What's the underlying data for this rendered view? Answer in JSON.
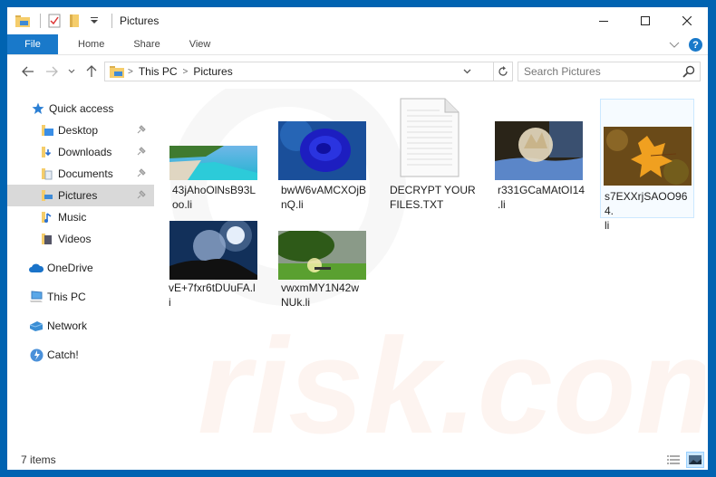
{
  "window": {
    "title": "Pictures",
    "controls": [
      "minimize",
      "maximize",
      "close"
    ]
  },
  "ribbon": {
    "tabs": [
      {
        "label": "File",
        "active": true
      },
      {
        "label": "Home"
      },
      {
        "label": "Share"
      },
      {
        "label": "View"
      }
    ],
    "help_label": "?"
  },
  "address_bar": {
    "crumbs": [
      "This PC",
      "Pictures"
    ],
    "separator": ">"
  },
  "search": {
    "placeholder": "Search Pictures"
  },
  "sidebar": {
    "items": [
      {
        "label": "Quick access",
        "icon": "star-icon",
        "level": 0
      },
      {
        "label": "Desktop",
        "icon": "desktop-folder-icon",
        "level": 1,
        "pinned": true
      },
      {
        "label": "Downloads",
        "icon": "downloads-folder-icon",
        "level": 1,
        "pinned": true
      },
      {
        "label": "Documents",
        "icon": "documents-folder-icon",
        "level": 1,
        "pinned": true
      },
      {
        "label": "Pictures",
        "icon": "pictures-folder-icon",
        "level": 1,
        "pinned": true,
        "selected": true
      },
      {
        "label": "Music",
        "icon": "music-folder-icon",
        "level": 1
      },
      {
        "label": "Videos",
        "icon": "videos-folder-icon",
        "level": 1
      },
      {
        "label": "OneDrive",
        "icon": "onedrive-icon",
        "level": 0
      },
      {
        "label": "This PC",
        "icon": "computer-icon",
        "level": 0
      },
      {
        "label": "Network",
        "icon": "network-icon",
        "level": 0
      },
      {
        "label": "Catch!",
        "icon": "catch-icon",
        "level": 0
      }
    ]
  },
  "files": [
    {
      "name": "43jAhoOlNsB93Loo.li",
      "line1": "43jAhoOlNsB93L",
      "line2": "oo.li",
      "thumb": "beach"
    },
    {
      "name": "bwW6vAMCXOjBnQ.li",
      "line1": "bwW6vAMCXOjB",
      "line2": "nQ.li",
      "thumb": "blue-rose"
    },
    {
      "name": "DECRYPT YOUR FILES.TXT",
      "line1": "DECRYPT YOUR",
      "line2": "FILES.TXT",
      "thumb": "text-document"
    },
    {
      "name": "r331GCaMAtOI14.li",
      "line1": "r331GCaMAtOI14",
      "line2": ".li",
      "thumb": "frozen-bubble"
    },
    {
      "name": "s7EXXrjSAOO964.li",
      "line1": "s7EXXrjSAOO964.",
      "line2": "li",
      "thumb": "autumn-leaf"
    },
    {
      "name": "vE+7fxr6tDUuFA.li",
      "line1": "vE+7fxr6tDUuFA.l",
      "line2": "i",
      "thumb": "bubble-sun"
    },
    {
      "name": "vwxmMY1N42wNUk.li",
      "line1": "vwxmMY1N42w",
      "line2": "NUk.li",
      "thumb": "tree-sunset"
    }
  ],
  "status": {
    "item_count": "7 items"
  },
  "colors": {
    "accent": "#1979ca",
    "frame": "#0063b1",
    "selection": "#d9d9d9"
  }
}
